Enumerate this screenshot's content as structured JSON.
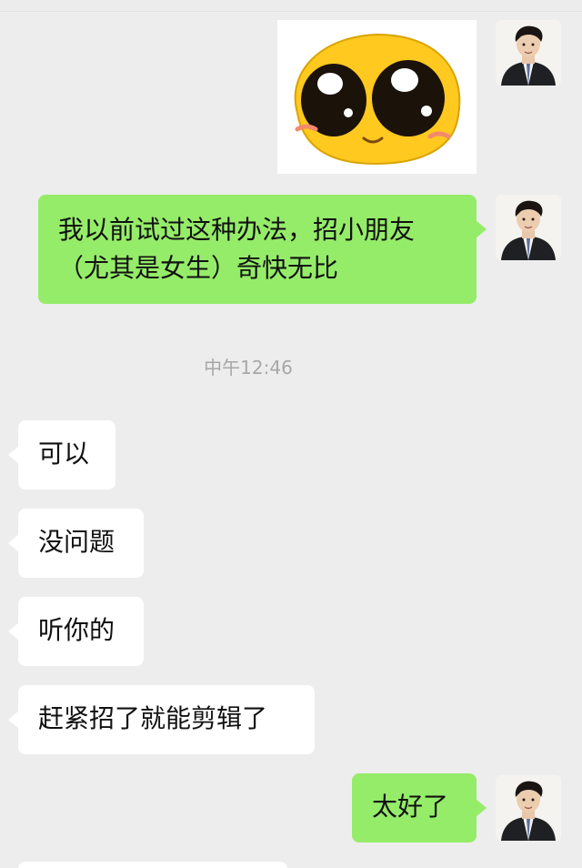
{
  "chat": {
    "timestamp": "中午12:46",
    "messages": [
      {
        "id": "m1",
        "side": "out",
        "type": "sticker",
        "sticker": "cute-pleading-emoji-sticker"
      },
      {
        "id": "m2",
        "side": "out",
        "type": "text",
        "lines": [
          "我以前试过这种办法，招小朋友",
          "（尤其是女生）奇快无比"
        ]
      },
      {
        "id": "m3",
        "side": "in",
        "type": "text",
        "text": "可以"
      },
      {
        "id": "m4",
        "side": "in",
        "type": "text",
        "text": "没问题"
      },
      {
        "id": "m5",
        "side": "in",
        "type": "text",
        "text": "听你的"
      },
      {
        "id": "m6",
        "side": "in",
        "type": "text",
        "text": "赶紧招了就能剪辑了"
      },
      {
        "id": "m7",
        "side": "out",
        "type": "text",
        "text": "太好了"
      }
    ]
  },
  "colors": {
    "background": "#ededed",
    "outgoing_bubble": "#95ec69",
    "incoming_bubble": "#ffffff",
    "timestamp_text": "#a7a7a7"
  },
  "icons": {
    "self_avatar": "user-avatar-photo",
    "sticker": "pleading-face-sticker"
  }
}
